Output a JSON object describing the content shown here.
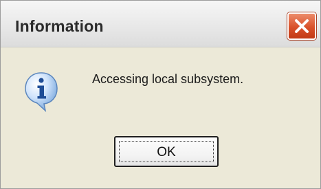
{
  "window": {
    "title": "Information",
    "close_icon": "close-icon",
    "accent_close": "#d9512a"
  },
  "content": {
    "icon": "info-icon",
    "message": "Accessing local subsystem."
  },
  "buttons": {
    "ok_label": "OK"
  }
}
